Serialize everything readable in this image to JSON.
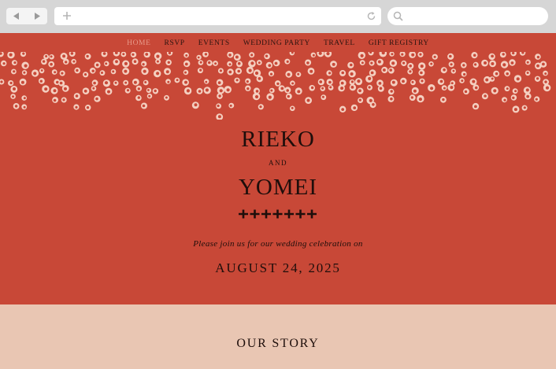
{
  "browser": {
    "back_icon": "back-arrow-icon",
    "forward_icon": "forward-arrow-icon",
    "new_tab_icon": "plus-icon",
    "reload_icon": "reload-icon",
    "search_icon": "search-icon"
  },
  "nav": {
    "items": [
      "HOME",
      "RSVP",
      "EVENTS",
      "WEDDING PARTY",
      "TRAVEL",
      "GIFT REGISTRY"
    ],
    "active": "HOME"
  },
  "hero": {
    "name_one": "RIEKO",
    "connector": "AND",
    "name_two": "YOMEI",
    "invitation": "Please join us for our wedding celebration on",
    "date": "AUGUST 24, 2025"
  },
  "story": {
    "title": "OUR STORY"
  },
  "colors": {
    "hero_bg": "#c84837",
    "dot": "#f4cfc0",
    "story_bg": "#e9c6b3",
    "text": "#1e0e0b",
    "active_nav": "#e89a8a"
  }
}
